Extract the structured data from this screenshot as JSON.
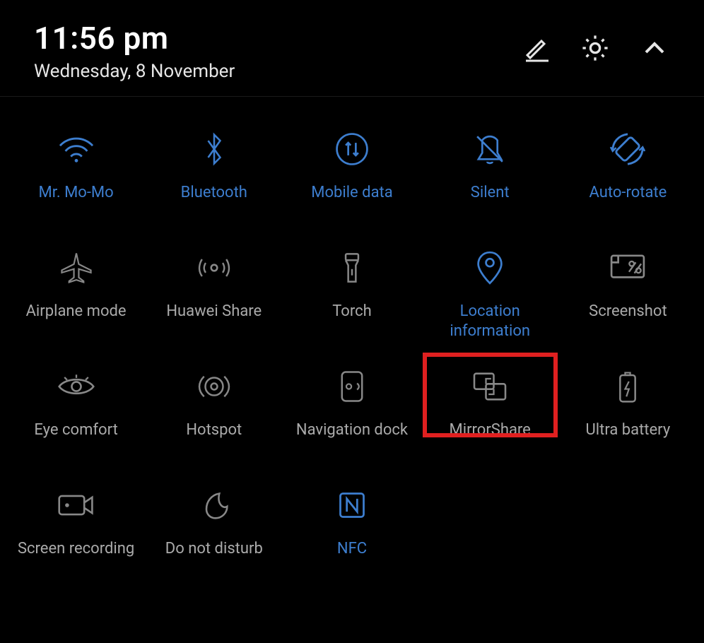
{
  "header": {
    "time": "11:56 pm",
    "date": "Wednesday, 8 November"
  },
  "tiles": [
    {
      "id": "wifi",
      "label": "Mr. Mo-Mo",
      "active": true
    },
    {
      "id": "bluetooth",
      "label": "Bluetooth",
      "active": true
    },
    {
      "id": "mobiledata",
      "label": "Mobile data",
      "active": true
    },
    {
      "id": "silent",
      "label": "Silent",
      "active": true
    },
    {
      "id": "autorotate",
      "label": "Auto-rotate",
      "active": true
    },
    {
      "id": "airplane",
      "label": "Airplane mode",
      "active": false
    },
    {
      "id": "huaweishare",
      "label": "Huawei Share",
      "active": false
    },
    {
      "id": "torch",
      "label": "Torch",
      "active": false
    },
    {
      "id": "location",
      "label": "Location information",
      "active": true
    },
    {
      "id": "screenshot",
      "label": "Screenshot",
      "active": false
    },
    {
      "id": "eyecomfort",
      "label": "Eye comfort",
      "active": false
    },
    {
      "id": "hotspot",
      "label": "Hotspot",
      "active": false
    },
    {
      "id": "navdock",
      "label": "Navigation dock",
      "active": false
    },
    {
      "id": "mirrorshare",
      "label": "MirrorShare",
      "active": false,
      "highlight": true
    },
    {
      "id": "ultrabatt",
      "label": "Ultra battery",
      "active": false
    },
    {
      "id": "screenrec",
      "label": "Screen recording",
      "active": false
    },
    {
      "id": "dnd",
      "label": "Do not disturb",
      "active": false
    },
    {
      "id": "nfc",
      "label": "NFC",
      "active": true
    }
  ]
}
